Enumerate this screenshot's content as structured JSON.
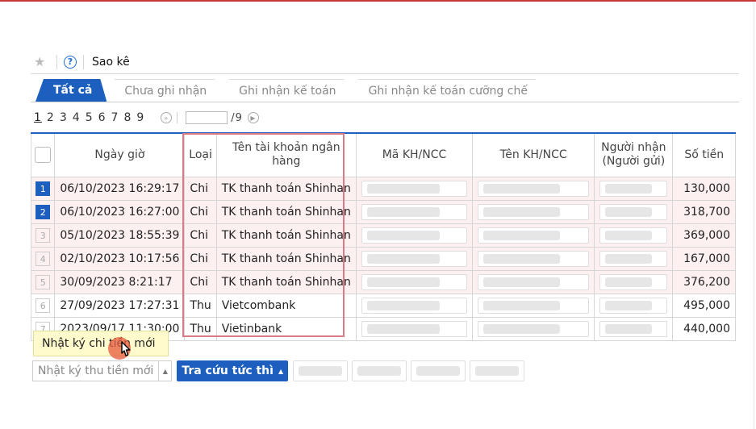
{
  "header": {
    "title": "Sao kê",
    "help_glyph": "?"
  },
  "tabs": [
    {
      "label": "Tất cả",
      "active": true
    },
    {
      "label": "Chưa ghi nhận",
      "active": false
    },
    {
      "label": "Ghi nhận kế toán",
      "active": false
    },
    {
      "label": "Ghi nhận kế toán cưỡng chế",
      "active": false
    }
  ],
  "pager": {
    "pages": [
      "1",
      "2",
      "3",
      "4",
      "5",
      "6",
      "7",
      "8",
      "9"
    ],
    "current": "1",
    "total": "/9"
  },
  "table": {
    "columns": [
      "Ngày giờ",
      "Loại",
      "Tên tài khoản ngân hàng",
      "Mã KH/NCC",
      "Tên KH/NCC",
      "Người nhận (Người gửi)",
      "Số tiền"
    ],
    "rows": [
      {
        "no": "1",
        "date": "06/10/2023 16:29:17",
        "type": "Chi",
        "account": "TK thanh toán Shinhan",
        "amount": "130,000"
      },
      {
        "no": "2",
        "date": "06/10/2023 16:27:00",
        "type": "Chi",
        "account": "TK thanh toán Shinhan",
        "amount": "318,700"
      },
      {
        "no": "3",
        "date": "05/10/2023 18:55:39",
        "type": "Chi",
        "account": "TK thanh toán Shinhan",
        "amount": "369,000"
      },
      {
        "no": "4",
        "date": "02/10/2023 10:17:56",
        "type": "Chi",
        "account": "TK thanh toán Shinhan",
        "amount": "167,000"
      },
      {
        "no": "5",
        "date": "30/09/2023 8:21:17",
        "type": "Chi",
        "account": "TK thanh toán Shinhan",
        "amount": "376,200"
      },
      {
        "no": "6",
        "date": "27/09/2023 17:27:31",
        "type": "Thu",
        "account": "Vietcombank",
        "amount": "495,000"
      },
      {
        "no": "7",
        "date": "2023/09/17 11:30:00",
        "type": "Thu",
        "account": "Vietinbank",
        "amount": "440,000"
      }
    ]
  },
  "tooltip": {
    "label": "Nhật ký chi tiền mới"
  },
  "bottom": {
    "income_journal": "Nhật ký thu tiền mới",
    "lookup": "Tra cứu tức thì"
  },
  "colors": {
    "accent": "#1c5fbe",
    "highlight_border": "#d77b87",
    "row_pink": "#fdf0f1",
    "tooltip_bg": "#fffbcc"
  }
}
